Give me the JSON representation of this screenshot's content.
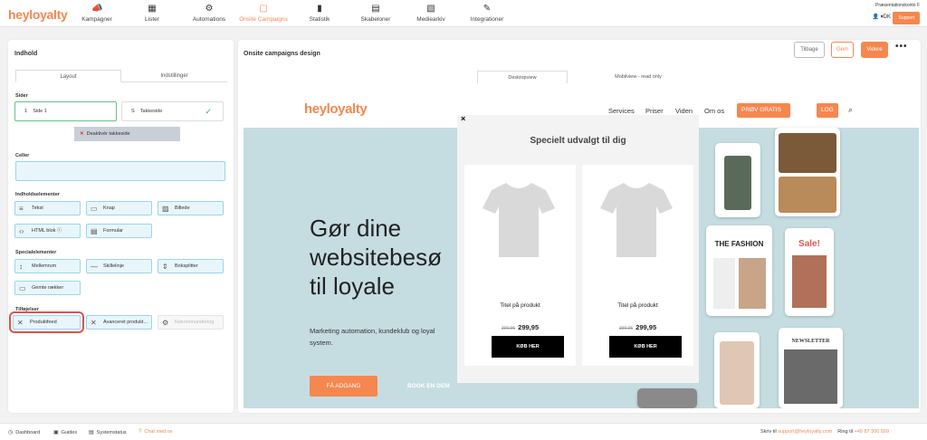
{
  "app": {
    "logo_text": "heyloyalty"
  },
  "nav": [
    {
      "label": "Kampagner",
      "icon": "megaphone-icon",
      "glyph": "📣"
    },
    {
      "label": "Lister",
      "icon": "grid-icon",
      "glyph": "▦"
    },
    {
      "label": "Automations",
      "icon": "nodes-icon",
      "glyph": "⚙"
    },
    {
      "label": "Onsite Campaigns",
      "icon": "window-icon",
      "glyph": "▢"
    },
    {
      "label": "Statistik",
      "icon": "chart-icon",
      "glyph": "▮"
    },
    {
      "label": "Skabeloner",
      "icon": "file-icon",
      "glyph": "▤"
    },
    {
      "label": "Mediearkiv",
      "icon": "image-icon",
      "glyph": "▧"
    },
    {
      "label": "Integrationer",
      "icon": "plug-icon",
      "glyph": "✎"
    }
  ],
  "account": {
    "name": "Præsentationskonto F",
    "lang": "DK",
    "support": "Support"
  },
  "left": {
    "title": "Indhold",
    "tabs": [
      "Layout",
      "Indstillinger"
    ],
    "pages_label": "Sider",
    "page1": "Side 1",
    "thanks_page": "Takkeside",
    "deactivate": "Deaktivér takkeside",
    "cells_label": "Celler",
    "content_label": "Indholdselementer",
    "content": [
      "Tekst",
      "Knap",
      "Billede",
      "HTML blok",
      "Formular"
    ],
    "special_label": "Specialelementer",
    "special": [
      "Mellemrum",
      "Skillelinje",
      "Boksplitter",
      "Gemte rækker"
    ],
    "addons_label": "Tilføjelser",
    "addons": [
      "Produktfeed",
      "Avanceret produkt...",
      "Rekommandering"
    ]
  },
  "right": {
    "title": "Onsite campaigns design",
    "back": "Tilbage",
    "save": "Gem",
    "next": "Videre",
    "view_tabs": [
      "Desktopview",
      "Mobilview - read only"
    ]
  },
  "preview": {
    "logo": "heyloyalty",
    "links": [
      "Services",
      "Priser",
      "Viden",
      "Om os"
    ],
    "try": "PRØV GRATIS",
    "login": "LOG IND",
    "headline": [
      "Gør dine",
      "websitebesø",
      "til loyale"
    ],
    "para": [
      "Marketing automation, kundeklub og loyal",
      "system."
    ],
    "cta": "FÅ ADGANG",
    "cta2": "BOOK EN DEM",
    "mock_fashion": "THE FASHION",
    "mock_sale": "Sale!",
    "mock_news": "NEWSLETTER"
  },
  "popup": {
    "close": "×",
    "title": "Specielt udvalgt til dig",
    "products": [
      {
        "name": "Titel på produkt",
        "old": "399,95",
        "price": "299,95",
        "buy": "KØB HER"
      },
      {
        "name": "Titel på produkt",
        "old": "399,95",
        "price": "299,95",
        "buy": "KØB HER"
      }
    ]
  },
  "footer": {
    "items": [
      "Dashboard",
      "Guides",
      "Systemstatus",
      "Chat med os"
    ],
    "write": "Skriv til",
    "email": "support@heyloyalty.com",
    "call": "Ring til",
    "phone": "+45 87 300 599"
  }
}
